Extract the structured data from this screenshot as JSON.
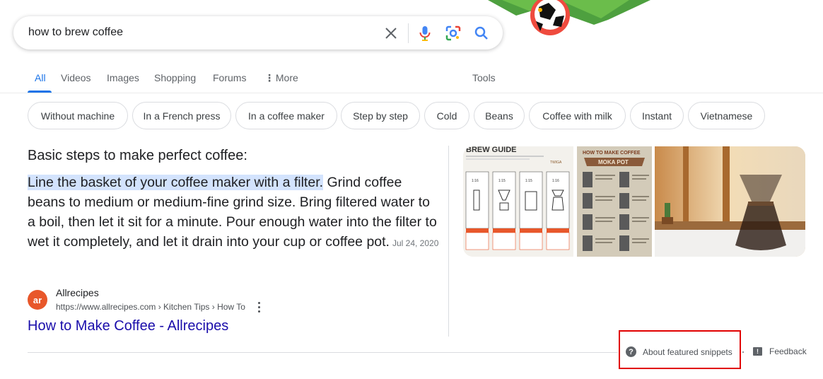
{
  "search": {
    "query": "how to brew coffee",
    "clear_icon": "close-icon",
    "voice_icon": "microphone-icon",
    "lens_icon": "camera-lens-icon",
    "search_icon": "search-icon"
  },
  "tabs": {
    "items": [
      {
        "label": "All",
        "active": true
      },
      {
        "label": "Videos"
      },
      {
        "label": "Images"
      },
      {
        "label": "Shopping"
      },
      {
        "label": "Forums"
      },
      {
        "label": "More",
        "icon": "vertical-dots-icon"
      }
    ],
    "tools_label": "Tools"
  },
  "chips": [
    "Without machine",
    "In a French press",
    "In a coffee maker",
    "Step by step",
    "Cold",
    "Beans",
    "Coffee with milk",
    "Instant",
    "Vietnamese"
  ],
  "snippet": {
    "heading": "Basic steps to make perfect coffee:",
    "highlight": "Line the basket of your coffee maker with a filter.",
    "body": " Grind coffee beans to medium or medium-fine grind size. Bring filtered water to a boil, then let it sit for a minute. Pour enough water into the filter to wet it completely, and let it drain into your cup or coffee pot.",
    "date": "Jul 24, 2020"
  },
  "images": {
    "img1": {
      "title": "BREW GUIDE",
      "brand": "TWIGA",
      "ratios": [
        "1:16",
        "1:15",
        "1:15",
        "1:16"
      ]
    },
    "img2": {
      "title": "HOW TO MAKE COFFEE",
      "subtitle": "MOKA POT"
    },
    "img3": {}
  },
  "source": {
    "favicon_text": "ar",
    "site_name": "Allrecipes",
    "url": "https://www.allrecipes.com › Kitchen Tips › How To",
    "title": "How to Make Coffee - Allrecipes"
  },
  "footer": {
    "about_label": "About featured snippets",
    "feedback_label": "Feedback"
  },
  "colors": {
    "accent": "#1a73e8",
    "link": "#1a0dab",
    "highlight": "#d3e3fd",
    "annotation_box": "#e10000"
  }
}
